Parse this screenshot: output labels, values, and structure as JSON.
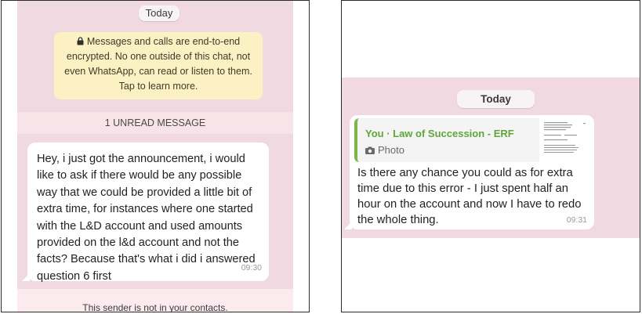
{
  "left": {
    "date_label": "Today",
    "encryption_notice": "Messages and calls are end-to-end encrypted. No one outside of this chat, not even WhatsApp, can read or listen to them. Tap to learn more.",
    "unread_label": "1 UNREAD MESSAGE",
    "message": {
      "text": "Hey, i just got the announcement, i would like to ask if there would be any possible way that we could be provided a little bit of extra time, for instances where one started with the L&D account and used amounts provided on the l&d account and not the facts?  Because that's what i did i answered question 6 first",
      "time": "09:30"
    },
    "sender_notice": "This sender is not in your contacts."
  },
  "right": {
    "date_label": "Today",
    "quoted": {
      "title": "You · Law of Succession - ERF",
      "media_label": "Photo"
    },
    "message": {
      "text": "Is there any chance you could as for extra time due to this error - I just spent half an hour on the account and now I have to redo the whole thing.",
      "time": "09:31"
    }
  },
  "colors": {
    "chat_background": "#f0d9e0",
    "encryption_notice_bg": "#fbf1c3",
    "quote_accent": "#7ab648"
  },
  "icons": [
    "lock-icon",
    "camera-icon"
  ]
}
